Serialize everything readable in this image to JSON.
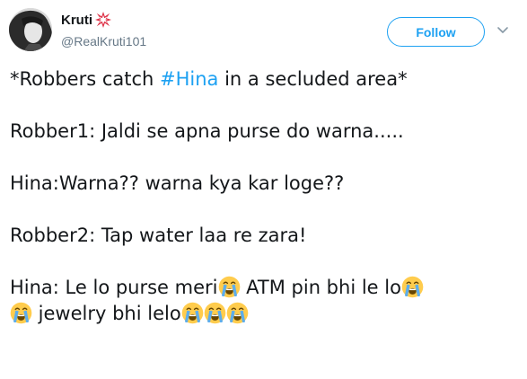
{
  "author": {
    "name": "Kruti",
    "handle": "@RealKruti101",
    "name_emoji": "explosion-icon"
  },
  "follow_label": "Follow",
  "tweet": {
    "line1_before": "*Robbers catch ",
    "hashtag": "#Hina",
    "line1_after": " in a secluded area*",
    "line2": "Robber1: Jaldi se apna purse do warna.....",
    "line3": "Hina:Warna?? warna kya kar loge??",
    "line4": "Robber2: Tap water laa re zara!",
    "line5_a": "Hina: Le lo purse meri",
    "line5_b": " ATM pin bhi le lo",
    "line6_a": " jewelry bhi lelo"
  },
  "emoji": "loudly-crying-face",
  "colors": {
    "accent": "#1da1f2",
    "text": "#14171a",
    "muted": "#657786",
    "emoji_face": "#ffcc4d",
    "emoji_tears": "#5dadec"
  }
}
